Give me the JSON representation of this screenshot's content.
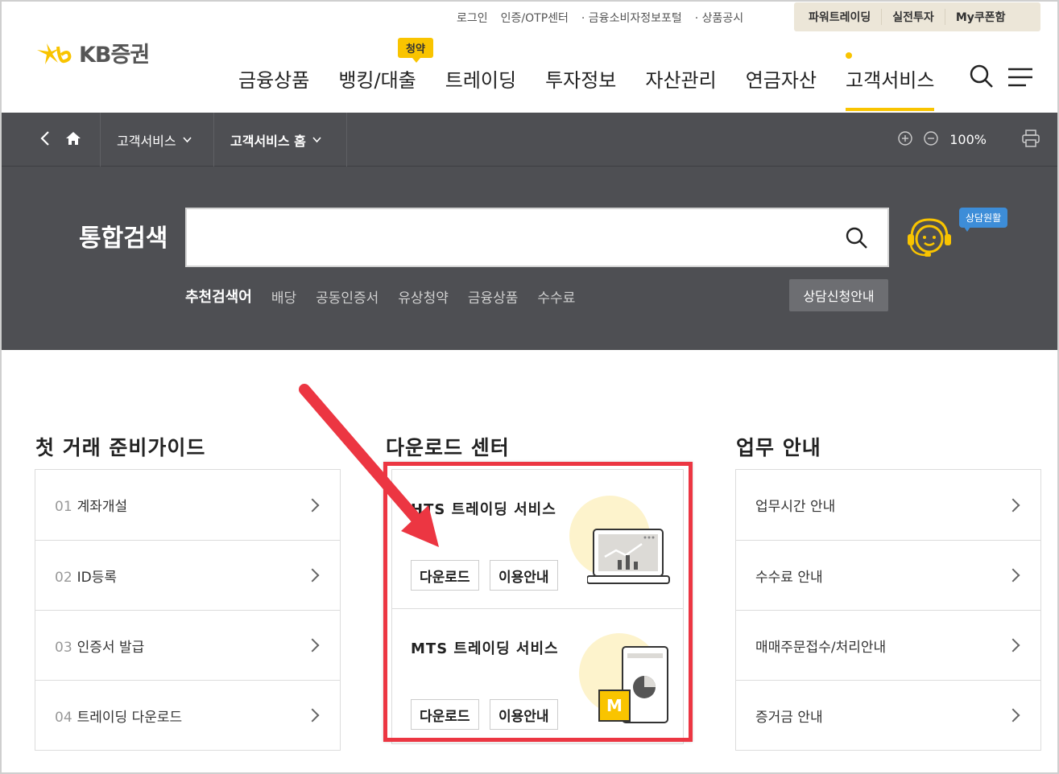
{
  "util_links": [
    "로그인",
    "인증/OTP센터",
    "· 금융소비자정보포털",
    "· 상품공시"
  ],
  "util_box": [
    "파워트레이딩",
    "실전투자",
    "My쿠폰함"
  ],
  "logo": {
    "text": "KB증권"
  },
  "badge": "청약",
  "gnb": [
    "금융상품",
    "뱅킹/대출",
    "트레이딩",
    "투자정보",
    "자산관리",
    "연금자산",
    "고객서비스"
  ],
  "location": {
    "level1": "고객서비스",
    "level2": "고객서비스 홈",
    "zoom": "100%"
  },
  "search": {
    "title": "통합검색",
    "placeholder": "",
    "rec_title": "추천검색어",
    "keywords": [
      "배당",
      "공동인증서",
      "유상청약",
      "금융상품",
      "수수료"
    ],
    "consult_button": "상담신청안내",
    "bubble": "상담원활"
  },
  "columns": {
    "guide": {
      "title": "첫 거래 준비가이드",
      "items": [
        {
          "num": "01",
          "label": "계좌개설"
        },
        {
          "num": "02",
          "label": "ID등록"
        },
        {
          "num": "03",
          "label": "인증서 발급"
        },
        {
          "num": "04",
          "label": "트레이딩 다운로드"
        }
      ]
    },
    "download": {
      "title": "다운로드 센터",
      "cards": [
        {
          "title": "HTS 트레이딩 서비스",
          "btn1": "다운로드",
          "btn2": "이용안내"
        },
        {
          "title": "MTS 트레이딩 서비스",
          "btn1": "다운로드",
          "btn2": "이용안내"
        }
      ],
      "mts_badge": "M"
    },
    "business": {
      "title": "업무 안내",
      "items": [
        "업무시간 안내",
        "수수료 안내",
        "매매주문접수/처리안내",
        "증거금 안내"
      ]
    }
  },
  "colors": {
    "accent": "#f9c400",
    "dark": "#4e4f53",
    "highlight": "#ec3642"
  }
}
